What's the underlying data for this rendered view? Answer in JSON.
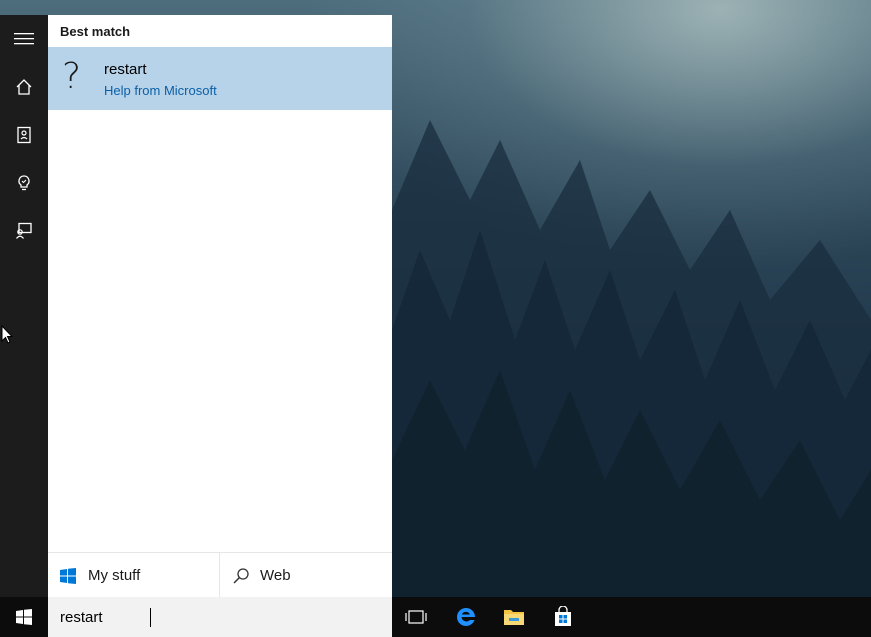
{
  "panel": {
    "header": "Best match",
    "best_match": {
      "icon": "question-mark-icon",
      "title": "restart",
      "subtitle": "Help from Microsoft"
    },
    "scopes": [
      {
        "label": "My stuff",
        "icon": "windows-logo-icon"
      },
      {
        "label": "Web",
        "icon": "search-icon"
      }
    ]
  },
  "left_rail": {
    "items": [
      {
        "icon": "hamburger-menu-icon"
      },
      {
        "icon": "home-icon"
      },
      {
        "icon": "notebook-icon"
      },
      {
        "icon": "lightbulb-icon"
      },
      {
        "icon": "feedback-icon"
      }
    ]
  },
  "search": {
    "value": "restart"
  },
  "taskbar": {
    "items": [
      {
        "icon": "windows-start-icon"
      },
      {
        "icon": "task-view-icon"
      },
      {
        "icon": "edge-browser-icon"
      },
      {
        "icon": "file-explorer-icon"
      },
      {
        "icon": "store-icon"
      }
    ]
  },
  "colors": {
    "highlight": "#b7d3ea",
    "link": "#0b5fa5",
    "rail": "#1c1c1c",
    "taskbar": "#0c0c0c",
    "accent": "#1e90ff"
  }
}
